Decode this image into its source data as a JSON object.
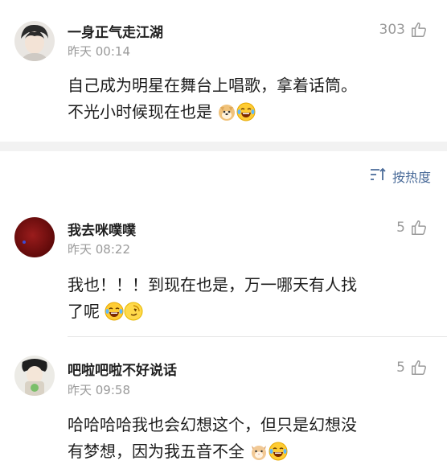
{
  "comments": [
    {
      "name": "一身正气走江湖",
      "time": "昨天 00:14",
      "likes": "303",
      "text_line1": "自己成为明星在舞台上唱歌，拿着话筒。",
      "text_line2": "不光小时候现在也是",
      "emojis": [
        "doge-icon",
        "laugh-cry-icon"
      ]
    },
    {
      "name": "我去咪噗噗",
      "time": "昨天 08:22",
      "likes": "5",
      "text_line1": "我也！！！到现在也是，万一哪天有人找",
      "text_line2": "了呢",
      "emojis": [
        "laugh-cry-icon",
        "smirk-icon"
      ]
    },
    {
      "name": "吧啦吧啦不好说话",
      "time": "昨天 09:58",
      "likes": "5",
      "text_line1": "哈哈哈哈我也会幻想这个，但只是幻想没",
      "text_line2": "有梦想，因为我五音不全",
      "emojis": [
        "cat-face-icon",
        "laugh-cry-icon"
      ]
    }
  ],
  "sort": {
    "label": "按热度",
    "icon": "sort-icon"
  },
  "colors": {
    "link_blue": "#4a6b99",
    "muted_gray": "#9a9a9a",
    "band_gray": "#f2f2f2"
  }
}
